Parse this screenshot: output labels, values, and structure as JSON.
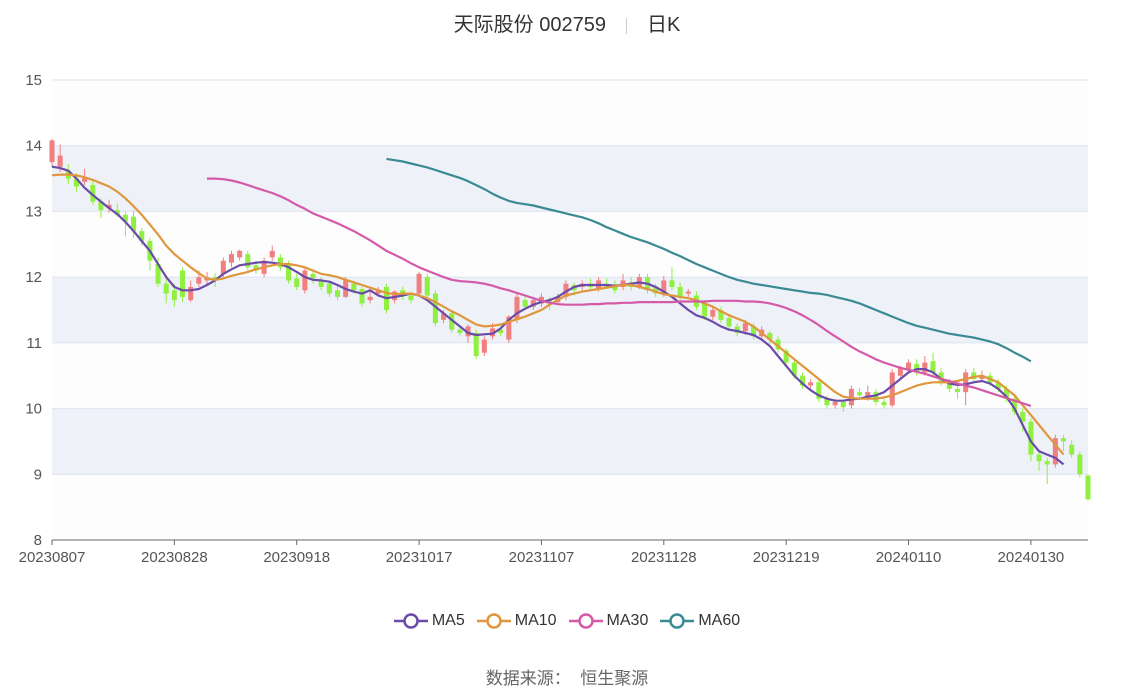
{
  "header": {
    "name": "天际股份 002759",
    "period": "日K"
  },
  "source": {
    "label": "数据来源：",
    "value": "恒生聚源"
  },
  "colors": {
    "up": "#f08080",
    "down": "#8ff040",
    "MA5": "#6a4ca8",
    "MA10": "#e0963c",
    "MA30": "#d45aa8",
    "MA60": "#3a8a94",
    "band": "#eef1f8",
    "grid": "#dde3ee"
  },
  "chart_data": {
    "type": "candlestick",
    "ylim": [
      8,
      15
    ],
    "yticks": [
      8,
      9,
      10,
      11,
      12,
      13,
      14,
      15
    ],
    "x_tick_labels": [
      "20230807",
      "20230828",
      "20230918",
      "20231017",
      "20231107",
      "20231128",
      "20231219",
      "20240110",
      "20240130"
    ],
    "x_tick_index": [
      0,
      15,
      30,
      45,
      60,
      75,
      90,
      105,
      120
    ],
    "candles": [
      [
        13.75,
        14.08,
        14.1,
        13.68
      ],
      [
        13.68,
        13.85,
        14.02,
        13.6
      ],
      [
        13.62,
        13.5,
        13.72,
        13.42
      ],
      [
        13.5,
        13.38,
        13.58,
        13.3
      ],
      [
        13.45,
        13.52,
        13.65,
        13.4
      ],
      [
        13.4,
        13.15,
        13.48,
        13.1
      ],
      [
        13.15,
        13.02,
        13.2,
        12.9
      ],
      [
        13.05,
        13.1,
        13.18,
        12.98
      ],
      [
        13.02,
        12.95,
        13.12,
        12.92
      ],
      [
        12.95,
        12.85,
        13.0,
        12.62
      ],
      [
        12.92,
        12.7,
        13.02,
        12.6
      ],
      [
        12.7,
        12.55,
        12.75,
        12.48
      ],
      [
        12.55,
        12.25,
        12.6,
        12.1
      ],
      [
        12.2,
        11.9,
        12.3,
        11.85
      ],
      [
        11.9,
        11.75,
        11.98,
        11.6
      ],
      [
        11.8,
        11.65,
        11.9,
        11.55
      ],
      [
        12.1,
        11.7,
        12.15,
        11.62
      ],
      [
        11.65,
        11.85,
        11.95,
        11.62
      ],
      [
        11.9,
        12.0,
        12.1,
        11.85
      ],
      [
        11.95,
        12.0,
        12.08,
        11.88
      ],
      [
        12.0,
        11.95,
        12.06,
        11.85
      ],
      [
        12.05,
        12.25,
        12.3,
        12.0
      ],
      [
        12.22,
        12.35,
        12.4,
        12.15
      ],
      [
        12.3,
        12.4,
        12.42,
        12.25
      ],
      [
        12.35,
        12.15,
        12.4,
        12.1
      ],
      [
        12.18,
        12.1,
        12.25,
        12.05
      ],
      [
        12.05,
        12.25,
        12.3,
        12.0
      ],
      [
        12.3,
        12.4,
        12.48,
        12.25
      ],
      [
        12.3,
        12.15,
        12.35,
        12.1
      ],
      [
        12.2,
        11.95,
        12.25,
        11.9
      ],
      [
        11.98,
        11.85,
        12.05,
        11.8
      ],
      [
        11.8,
        12.1,
        12.15,
        11.75
      ],
      [
        12.05,
        11.98,
        12.1,
        11.9
      ],
      [
        11.95,
        11.85,
        12.0,
        11.8
      ],
      [
        11.9,
        11.75,
        11.95,
        11.7
      ],
      [
        11.8,
        11.7,
        11.88,
        11.65
      ],
      [
        11.7,
        11.95,
        12.0,
        11.68
      ],
      [
        11.9,
        11.8,
        11.95,
        11.75
      ],
      [
        11.82,
        11.6,
        11.85,
        11.55
      ],
      [
        11.65,
        11.7,
        11.8,
        11.6
      ],
      [
        11.75,
        11.8,
        11.85,
        11.7
      ],
      [
        11.85,
        11.5,
        11.9,
        11.45
      ],
      [
        11.65,
        11.78,
        11.8,
        11.6
      ],
      [
        11.8,
        11.72,
        11.85,
        11.65
      ],
      [
        11.72,
        11.65,
        11.78,
        11.6
      ],
      [
        11.75,
        12.05,
        12.08,
        11.7
      ],
      [
        12.0,
        11.72,
        12.05,
        11.68
      ],
      [
        11.75,
        11.3,
        11.8,
        11.25
      ],
      [
        11.35,
        11.45,
        11.5,
        11.3
      ],
      [
        11.45,
        11.2,
        11.5,
        11.15
      ],
      [
        11.2,
        11.15,
        11.25,
        11.1
      ],
      [
        11.1,
        11.25,
        11.28,
        11.0
      ],
      [
        11.15,
        10.8,
        11.2,
        10.75
      ],
      [
        10.85,
        11.05,
        11.1,
        10.8
      ],
      [
        11.1,
        11.22,
        11.3,
        11.05
      ],
      [
        11.2,
        11.15,
        11.25,
        11.1
      ],
      [
        11.05,
        11.4,
        11.42,
        11.0
      ],
      [
        11.35,
        11.7,
        11.75,
        11.3
      ],
      [
        11.65,
        11.55,
        11.7,
        11.5
      ],
      [
        11.55,
        11.65,
        11.7,
        11.5
      ],
      [
        11.6,
        11.7,
        11.75,
        11.55
      ],
      [
        11.65,
        11.6,
        11.7,
        11.5
      ],
      [
        11.62,
        11.7,
        11.75,
        11.58
      ],
      [
        11.7,
        11.9,
        11.95,
        11.65
      ],
      [
        11.88,
        11.8,
        11.92,
        11.72
      ],
      [
        11.85,
        11.9,
        11.95,
        11.8
      ],
      [
        11.9,
        11.85,
        11.98,
        11.8
      ],
      [
        11.82,
        11.95,
        12.0,
        11.78
      ],
      [
        11.9,
        11.85,
        11.98,
        11.82
      ],
      [
        11.88,
        11.8,
        11.95,
        11.75
      ],
      [
        11.85,
        11.95,
        12.05,
        11.8
      ],
      [
        11.92,
        11.85,
        12.0,
        11.8
      ],
      [
        11.85,
        12.0,
        12.05,
        11.82
      ],
      [
        12.0,
        11.8,
        12.05,
        11.75
      ],
      [
        11.85,
        11.75,
        11.9,
        11.7
      ],
      [
        11.75,
        11.95,
        12.02,
        11.7
      ],
      [
        11.95,
        11.85,
        12.15,
        11.8
      ],
      [
        11.85,
        11.7,
        11.92,
        11.65
      ],
      [
        11.75,
        11.78,
        11.82,
        11.7
      ],
      [
        11.72,
        11.55,
        11.78,
        11.5
      ],
      [
        11.6,
        11.4,
        11.65,
        11.35
      ],
      [
        11.4,
        11.5,
        11.55,
        11.35
      ],
      [
        11.5,
        11.35,
        11.55,
        11.3
      ],
      [
        11.38,
        11.25,
        11.42,
        11.2
      ],
      [
        11.25,
        11.15,
        11.3,
        11.1
      ],
      [
        11.18,
        11.3,
        11.35,
        11.12
      ],
      [
        11.25,
        11.1,
        11.3,
        11.05
      ],
      [
        11.1,
        11.2,
        11.25,
        11.05
      ],
      [
        11.15,
        11.05,
        11.18,
        10.98
      ],
      [
        11.05,
        10.9,
        11.1,
        10.85
      ],
      [
        10.88,
        10.7,
        10.92,
        10.65
      ],
      [
        10.7,
        10.5,
        10.75,
        10.45
      ],
      [
        10.5,
        10.35,
        10.55,
        10.3
      ],
      [
        10.35,
        10.4,
        10.45,
        10.3
      ],
      [
        10.4,
        10.15,
        10.45,
        10.1
      ],
      [
        10.15,
        10.05,
        10.2,
        10.0
      ],
      [
        10.05,
        10.1,
        10.15,
        10.0
      ],
      [
        10.1,
        10.02,
        10.12,
        9.95
      ],
      [
        10.05,
        10.3,
        10.35,
        10.0
      ],
      [
        10.25,
        10.2,
        10.32,
        10.15
      ],
      [
        10.18,
        10.25,
        10.35,
        10.12
      ],
      [
        10.25,
        10.1,
        10.3,
        10.05
      ],
      [
        10.1,
        10.05,
        10.15,
        10.0
      ],
      [
        10.05,
        10.55,
        10.6,
        10.02
      ],
      [
        10.5,
        10.62,
        10.65,
        10.45
      ],
      [
        10.6,
        10.7,
        10.75,
        10.55
      ],
      [
        10.68,
        10.55,
        10.75,
        10.5
      ],
      [
        10.55,
        10.7,
        10.8,
        10.5
      ],
      [
        10.72,
        10.55,
        10.85,
        10.5
      ],
      [
        10.55,
        10.4,
        10.62,
        10.35
      ],
      [
        10.4,
        10.3,
        10.45,
        10.25
      ],
      [
        10.3,
        10.25,
        10.35,
        10.15
      ],
      [
        10.25,
        10.55,
        10.6,
        10.05
      ],
      [
        10.55,
        10.45,
        10.62,
        10.4
      ],
      [
        10.45,
        10.5,
        10.58,
        10.4
      ],
      [
        10.5,
        10.4,
        10.55,
        10.35
      ],
      [
        10.4,
        10.3,
        10.45,
        10.25
      ],
      [
        10.3,
        10.15,
        10.35,
        10.1
      ],
      [
        10.15,
        9.95,
        10.2,
        9.9
      ],
      [
        9.95,
        9.8,
        10.0,
        9.65
      ],
      [
        9.8,
        9.3,
        9.85,
        9.2
      ],
      [
        9.3,
        9.2,
        9.35,
        9.05
      ],
      [
        9.2,
        9.15,
        9.25,
        8.85
      ],
      [
        9.15,
        9.55,
        9.6,
        9.1
      ],
      [
        9.55,
        9.5,
        9.6,
        9.35
      ],
      [
        9.45,
        9.3,
        9.52,
        9.25
      ],
      [
        9.3,
        9.0,
        9.35,
        8.95
      ],
      [
        8.98,
        8.62,
        9.0,
        8.6
      ]
    ],
    "series": [
      {
        "name": "MA5",
        "values": [
          13.68,
          13.66,
          13.62,
          13.5,
          13.36,
          13.25,
          13.15,
          13.05,
          12.96,
          12.84,
          12.7,
          12.55,
          12.4,
          12.2,
          12.0,
          11.85,
          11.8,
          11.8,
          11.82,
          11.88,
          11.95,
          12.05,
          12.12,
          12.18,
          12.2,
          12.22,
          12.23,
          12.22,
          12.2,
          12.15,
          12.08,
          12.0,
          11.96,
          11.95,
          11.93,
          11.88,
          11.82,
          11.78,
          11.75,
          11.8,
          11.72,
          11.68,
          11.7,
          11.72,
          11.75,
          11.72,
          11.65,
          11.55,
          11.45,
          11.35,
          11.25,
          11.15,
          11.12,
          11.13,
          11.14,
          11.22,
          11.35,
          11.45,
          11.52,
          11.58,
          11.62,
          11.65,
          11.7,
          11.78,
          11.85,
          11.88,
          11.88,
          11.88,
          11.88,
          11.87,
          11.88,
          11.9,
          11.92,
          11.9,
          11.85,
          11.78,
          11.7,
          11.6,
          11.5,
          11.42,
          11.38,
          11.32,
          11.25,
          11.2,
          11.18,
          11.15,
          11.12,
          11.05,
          10.95,
          10.8,
          10.65,
          10.5,
          10.38,
          10.28,
          10.2,
          10.15,
          10.12,
          10.12,
          10.14,
          10.15,
          10.18,
          10.2,
          10.25,
          10.35,
          10.45,
          10.55,
          10.6,
          10.6,
          10.55,
          10.45,
          10.38,
          10.36,
          10.37,
          10.4,
          10.42,
          10.38,
          10.3,
          10.18,
          10.0,
          9.75,
          9.5,
          9.35,
          9.3,
          9.25,
          9.15
        ]
      },
      {
        "name": "MA10",
        "values": [
          13.55,
          13.56,
          13.56,
          13.55,
          13.52,
          13.48,
          13.43,
          13.38,
          13.3,
          13.2,
          13.08,
          12.95,
          12.8,
          12.65,
          12.48,
          12.35,
          12.25,
          12.15,
          12.06,
          11.98,
          11.96,
          11.98,
          12.02,
          12.05,
          12.08,
          12.12,
          12.15,
          12.18,
          12.2,
          12.2,
          12.18,
          12.15,
          12.1,
          12.05,
          12.03,
          12.0,
          11.96,
          11.92,
          11.88,
          11.84,
          11.8,
          11.76,
          11.74,
          11.75,
          11.75,
          11.72,
          11.68,
          11.62,
          11.55,
          11.48,
          11.42,
          11.35,
          11.28,
          11.25,
          11.26,
          11.28,
          11.32,
          11.36,
          11.4,
          11.45,
          11.5,
          11.58,
          11.65,
          11.72,
          11.75,
          11.78,
          11.8,
          11.82,
          11.84,
          11.86,
          11.88,
          11.88,
          11.85,
          11.82,
          11.78,
          11.74,
          11.72,
          11.7,
          11.68,
          11.65,
          11.6,
          11.55,
          11.48,
          11.42,
          11.37,
          11.32,
          11.25,
          11.15,
          11.05,
          10.95,
          10.85,
          10.75,
          10.65,
          10.55,
          10.45,
          10.35,
          10.25,
          10.18,
          10.16,
          10.15,
          10.15,
          10.15,
          10.17,
          10.2,
          10.25,
          10.3,
          10.35,
          10.38,
          10.4,
          10.4,
          10.4,
          10.42,
          10.45,
          10.48,
          10.5,
          10.45,
          10.4,
          10.3,
          10.2,
          10.05,
          9.9,
          9.75,
          9.6,
          9.45,
          9.3
        ]
      },
      {
        "name": "MA30",
        "values": [
          13.5,
          13.5,
          13.49,
          13.47,
          13.44,
          13.4,
          13.36,
          13.32,
          13.28,
          13.23,
          13.17,
          13.1,
          13.04,
          12.97,
          12.92,
          12.87,
          12.82,
          12.76,
          12.7,
          12.63,
          12.56,
          12.48,
          12.4,
          12.34,
          12.28,
          12.21,
          12.15,
          12.1,
          12.05,
          12.0,
          11.96,
          11.94,
          11.93,
          11.92,
          11.9,
          11.87,
          11.83,
          11.8,
          11.76,
          11.72,
          11.68,
          11.64,
          11.61,
          11.59,
          11.58,
          11.58,
          11.58,
          11.59,
          11.59,
          11.6,
          11.6,
          11.61,
          11.61,
          11.62,
          11.62,
          11.62,
          11.62,
          11.62,
          11.63,
          11.63,
          11.63,
          11.63,
          11.64,
          11.64,
          11.64,
          11.64,
          11.63,
          11.63,
          11.62,
          11.6,
          11.57,
          11.53,
          11.48,
          11.42,
          11.35,
          11.27,
          11.18,
          11.1,
          11.02,
          10.94,
          10.87,
          10.81,
          10.75,
          10.7,
          10.66,
          10.62,
          10.59,
          10.56,
          10.53,
          10.49,
          10.45,
          10.42,
          10.38,
          10.35,
          10.32,
          10.28,
          10.24,
          10.2,
          10.16,
          10.12,
          10.08,
          10.04
        ]
      },
      {
        "name": "MA60",
        "values": [
          13.8,
          13.78,
          13.76,
          13.73,
          13.7,
          13.67,
          13.63,
          13.59,
          13.55,
          13.51,
          13.46,
          13.4,
          13.34,
          13.27,
          13.21,
          13.16,
          13.13,
          13.11,
          13.09,
          13.06,
          13.03,
          13.0,
          12.97,
          12.94,
          12.91,
          12.87,
          12.82,
          12.76,
          12.71,
          12.66,
          12.61,
          12.57,
          12.53,
          12.48,
          12.43,
          12.37,
          12.32,
          12.26,
          12.2,
          12.15,
          12.1,
          12.05,
          12.0,
          11.96,
          11.93,
          11.9,
          11.88,
          11.86,
          11.84,
          11.82,
          11.8,
          11.78,
          11.76,
          11.75,
          11.73,
          11.7,
          11.67,
          11.64,
          11.6,
          11.55,
          11.5,
          11.45,
          11.4,
          11.35,
          11.3,
          11.26,
          11.23,
          11.2,
          11.17,
          11.14,
          11.12,
          11.1,
          11.08,
          11.05,
          11.02,
          10.98,
          10.92,
          10.85,
          10.79,
          10.72
        ]
      }
    ],
    "ma30_start_index": 19,
    "ma60_start_index": 41
  }
}
